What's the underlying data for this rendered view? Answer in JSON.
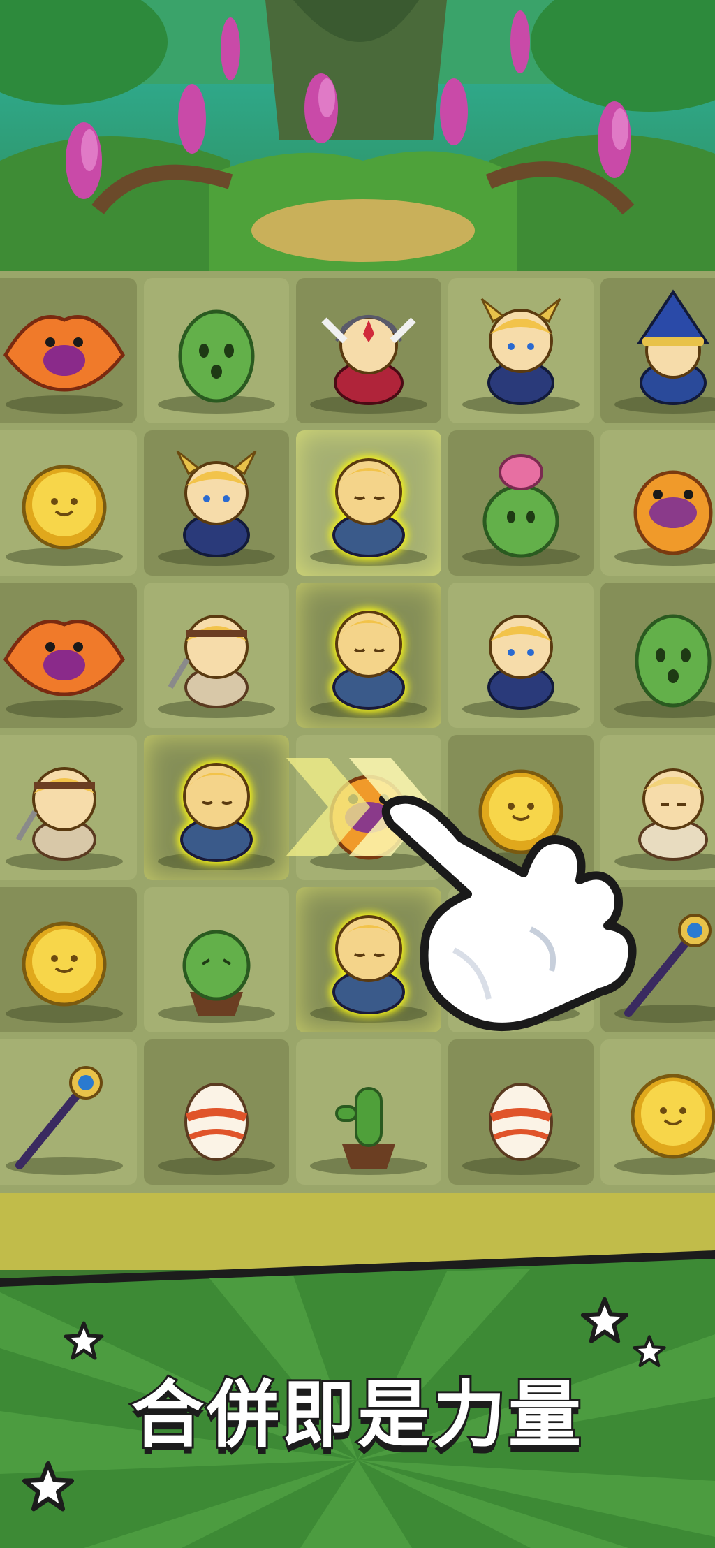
{
  "banner": {
    "slogan": "合併即是力量",
    "colors": {
      "green": "#3d8a35",
      "ray": "#4c9c40",
      "text": "#ffffff",
      "outline": "#1c1c1c"
    }
  },
  "board": {
    "rows": 6,
    "cols": 5,
    "tiles": [
      [
        "phoenix-dragon",
        "cactus-monster",
        "valkyrie-knight",
        "horned-prince",
        "blue-wizard"
      ],
      [
        "gold-coin",
        "horned-prince",
        "sleeping-monk",
        "flower-cactus",
        "orange-bird"
      ],
      [
        "phoenix-dragon",
        "swordsman-boy",
        "sleeping-monk",
        "blonde-mage",
        "cactus-monster"
      ],
      [
        "swordsman-boy",
        "sleeping-monk",
        "orange-bird",
        "gold-coin",
        "meditating-boy"
      ],
      [
        "gold-coin",
        "potted-cactus-monster",
        "sleeping-monk",
        "cactus-monster",
        "magic-staff"
      ],
      [
        "magic-staff",
        "egg",
        "potted-cactus",
        "egg",
        "gold-coin"
      ]
    ],
    "highlighted": [
      [
        1,
        2
      ],
      [
        2,
        2
      ],
      [
        3,
        1
      ],
      [
        4,
        2
      ]
    ]
  },
  "tutorial": {
    "hand_icon": "pointing-hand-icon",
    "arrow_icon": "swipe-arrow-icon"
  }
}
